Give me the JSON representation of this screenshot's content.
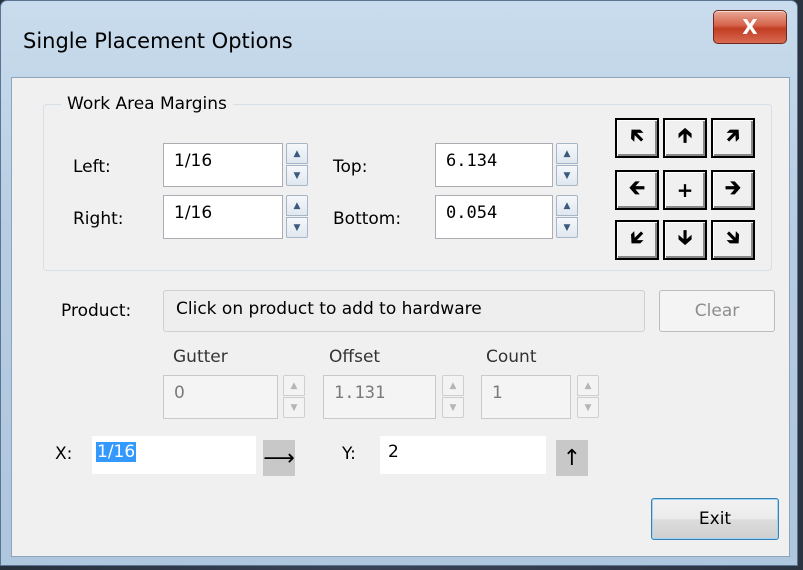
{
  "window": {
    "title": "Single Placement Options",
    "close_label": "X"
  },
  "margins": {
    "group_label": "Work Area Margins",
    "left_label": "Left:",
    "left_value": "1/16",
    "top_label": "Top:",
    "top_value": "6.134",
    "right_label": "Right:",
    "right_value": "1/16",
    "bottom_label": "Bottom:",
    "bottom_value": "0.054"
  },
  "nudge": {
    "up_left": "🡴",
    "up": "🡱",
    "up_right": "🡵",
    "left": "🡰",
    "center": "+",
    "right": "🡲",
    "down_left": "🡷",
    "down": "🡳",
    "down_right": "🡶"
  },
  "product": {
    "label": "Product:",
    "value": "Click on product to add to hardware",
    "clear_label": "Clear"
  },
  "spacing": {
    "gutter_label": "Gutter",
    "gutter_value": "0",
    "offset_label": "Offset",
    "offset_value": "1.131",
    "count_label": "Count",
    "count_value": "1"
  },
  "position": {
    "x_label": "X:",
    "x_value": "1/16",
    "x_arrow": "⟶",
    "y_label": "Y:",
    "y_value": "2",
    "y_arrow": "↑"
  },
  "footer": {
    "exit_label": "Exit"
  }
}
